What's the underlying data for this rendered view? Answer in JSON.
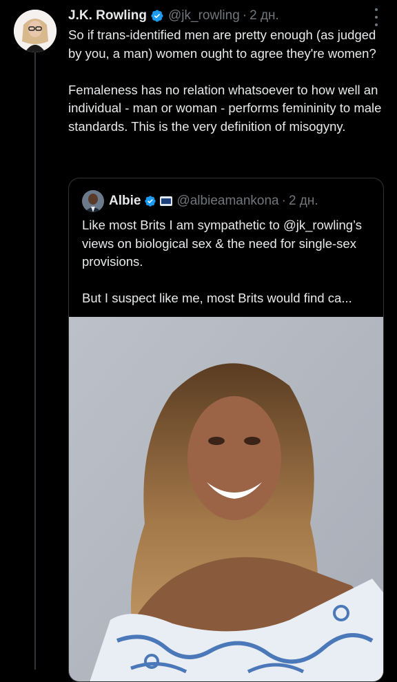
{
  "tweet": {
    "author_name": "J.K. Rowling",
    "author_handle": "@jk_rowling",
    "separator": "·",
    "time": "2 дн.",
    "text": "So if trans-identified men are pretty enough (as judged by you, a man) women ought to agree they're women?\n\nFemaleness has no relation whatsoever to how well an individual - man or woman - performs femininity to male standards. This is the very definition of misogyny."
  },
  "quote": {
    "author_name": "Albie",
    "author_handle": "@albieamankona",
    "separator": "·",
    "time": "2 дн.",
    "text": "Like most Brits I am sympathetic to @jk_rowling’s views on biological sex & the need for single-sex provisions.\n\nBut I suspect like me, most Brits would find ca..."
  },
  "colors": {
    "background": "#000000",
    "text": "#e7e9ea",
    "secondary": "#71767b",
    "verified": "#1d9bf0",
    "border": "#2f3336"
  },
  "icons": {
    "verified": "verified-badge-icon",
    "more": "more-options-icon",
    "affiliation": "news-outlet-badge-icon"
  }
}
